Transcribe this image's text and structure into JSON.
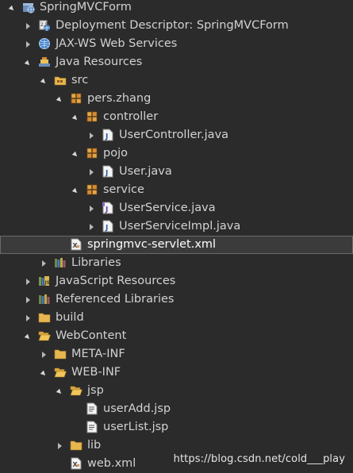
{
  "tree": {
    "items": [
      {
        "label": "SpringMVCForm",
        "depth": 0,
        "arrow": "expanded",
        "icon": "web-project-icon"
      },
      {
        "label": "Deployment Descriptor: SpringMVCForm",
        "depth": 1,
        "arrow": "collapsed",
        "icon": "deployment-descriptor-icon"
      },
      {
        "label": "JAX-WS Web Services",
        "depth": 1,
        "arrow": "collapsed",
        "icon": "web-services-icon"
      },
      {
        "label": "Java Resources",
        "depth": 1,
        "arrow": "expanded",
        "icon": "java-resources-icon"
      },
      {
        "label": "src",
        "depth": 2,
        "arrow": "expanded",
        "icon": "source-folder-icon"
      },
      {
        "label": "pers.zhang",
        "depth": 3,
        "arrow": "expanded",
        "icon": "package-icon"
      },
      {
        "label": "controller",
        "depth": 4,
        "arrow": "expanded",
        "icon": "package-icon"
      },
      {
        "label": "UserController.java",
        "depth": 5,
        "arrow": "collapsed",
        "icon": "java-file-icon"
      },
      {
        "label": "pojo",
        "depth": 4,
        "arrow": "expanded",
        "icon": "package-icon"
      },
      {
        "label": "User.java",
        "depth": 5,
        "arrow": "collapsed",
        "icon": "java-file-icon"
      },
      {
        "label": "service",
        "depth": 4,
        "arrow": "expanded",
        "icon": "package-icon"
      },
      {
        "label": "UserService.java",
        "depth": 5,
        "arrow": "collapsed",
        "icon": "java-interface-file-icon"
      },
      {
        "label": "UserServiceImpl.java",
        "depth": 5,
        "arrow": "collapsed",
        "icon": "java-file-icon"
      },
      {
        "label": "springmvc-servlet.xml",
        "depth": 3,
        "arrow": "none",
        "icon": "xml-file-icon",
        "selected": true
      },
      {
        "label": "Libraries",
        "depth": 2,
        "arrow": "collapsed",
        "icon": "libraries-icon"
      },
      {
        "label": "JavaScript Resources",
        "depth": 1,
        "arrow": "collapsed",
        "icon": "javascript-resources-icon"
      },
      {
        "label": "Referenced Libraries",
        "depth": 1,
        "arrow": "collapsed",
        "icon": "libraries-icon"
      },
      {
        "label": "build",
        "depth": 1,
        "arrow": "collapsed",
        "icon": "folder-icon"
      },
      {
        "label": "WebContent",
        "depth": 1,
        "arrow": "expanded",
        "icon": "folder-open-icon"
      },
      {
        "label": "META-INF",
        "depth": 2,
        "arrow": "collapsed",
        "icon": "folder-icon"
      },
      {
        "label": "WEB-INF",
        "depth": 2,
        "arrow": "expanded",
        "icon": "folder-open-icon"
      },
      {
        "label": "jsp",
        "depth": 3,
        "arrow": "expanded",
        "icon": "folder-open-icon"
      },
      {
        "label": "userAdd.jsp",
        "depth": 4,
        "arrow": "none",
        "icon": "jsp-file-icon"
      },
      {
        "label": "userList.jsp",
        "depth": 4,
        "arrow": "none",
        "icon": "jsp-file-icon"
      },
      {
        "label": "lib",
        "depth": 3,
        "arrow": "collapsed",
        "icon": "folder-icon"
      },
      {
        "label": "web.xml",
        "depth": 3,
        "arrow": "none",
        "icon": "xml-file-icon"
      }
    ]
  },
  "watermark": "https://blog.csdn.net/cold___play"
}
